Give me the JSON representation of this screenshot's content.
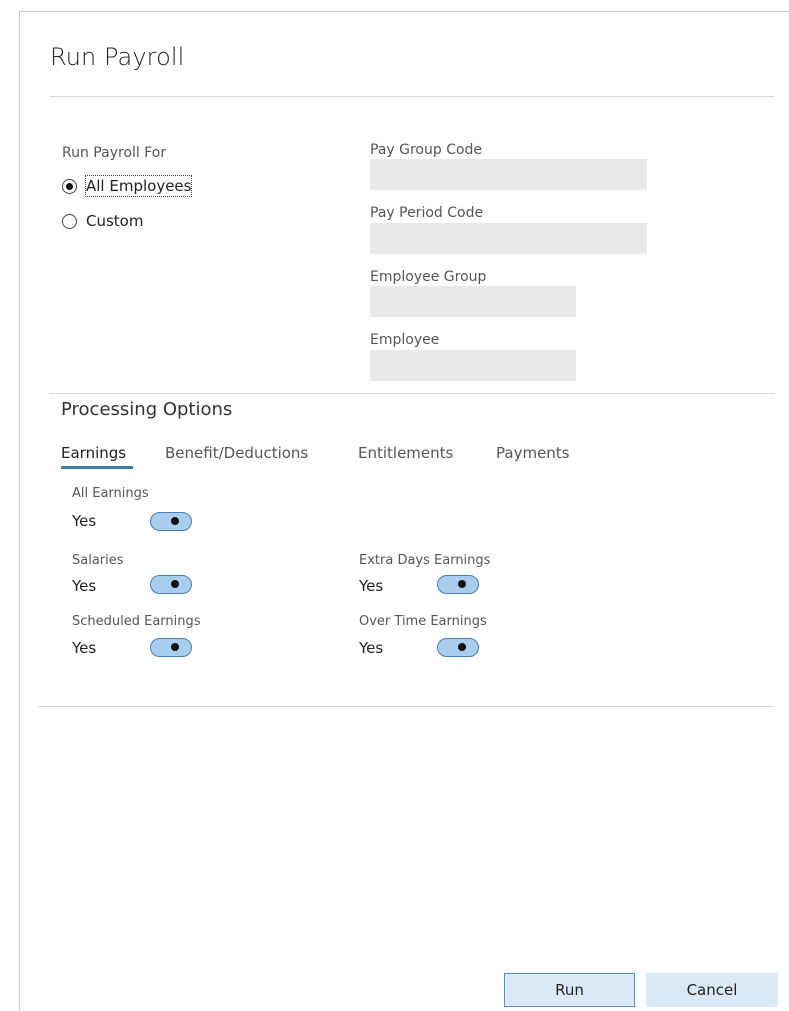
{
  "dialog": {
    "title": "Run Payroll"
  },
  "run_for": {
    "label": "Run Payroll For",
    "options": [
      {
        "label": "All Employees",
        "selected": true
      },
      {
        "label": "Custom",
        "selected": false
      }
    ]
  },
  "fields": {
    "pay_group_code": {
      "label": "Pay Group Code",
      "value": ""
    },
    "pay_period_code": {
      "label": "Pay Period Code",
      "value": ""
    },
    "employee_group": {
      "label": "Employee Group",
      "value": ""
    },
    "employee": {
      "label": "Employee",
      "value": ""
    }
  },
  "processing": {
    "title": "Processing Options",
    "tabs": [
      {
        "label": "Earnings",
        "active": true
      },
      {
        "label": "Benefit/Deductions",
        "active": false
      },
      {
        "label": "Entitlements",
        "active": false
      },
      {
        "label": "Payments",
        "active": false
      }
    ],
    "options": {
      "all_earnings": {
        "label": "All Earnings",
        "value": "Yes",
        "on": true
      },
      "salaries": {
        "label": "Salaries",
        "value": "Yes",
        "on": true
      },
      "extra_days_earnings": {
        "label": "Extra Days Earnings",
        "value": "Yes",
        "on": true
      },
      "scheduled_earnings": {
        "label": "Scheduled Earnings",
        "value": "Yes",
        "on": true
      },
      "over_time_earnings": {
        "label": "Over Time Earnings",
        "value": "Yes",
        "on": true
      }
    }
  },
  "buttons": {
    "run": "Run",
    "cancel": "Cancel"
  },
  "colors": {
    "accent": "#3d7fa6",
    "toggle_fill": "#a9cdec",
    "toggle_border": "#4a7fb3",
    "input_bg": "#e9e9e9",
    "button_bg": "#dbe8f6"
  }
}
